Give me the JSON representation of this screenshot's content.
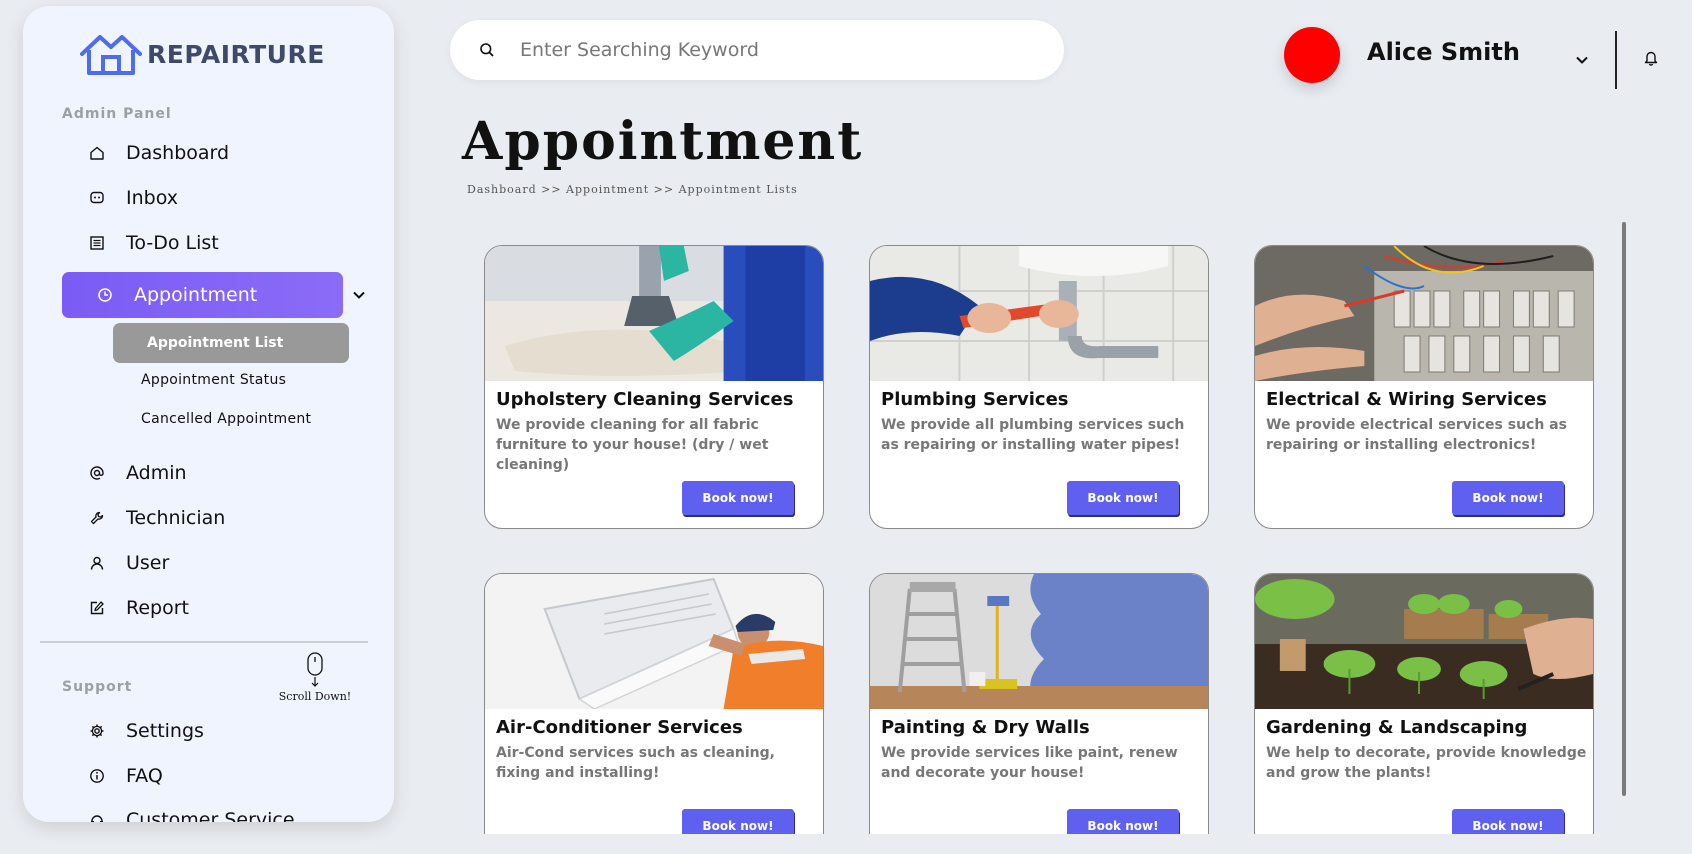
{
  "brand": {
    "name": "REPAIRTURE",
    "accent": "#4f6cf0"
  },
  "sidebar": {
    "admin_label": "Admin Panel",
    "items": [
      {
        "label": "Dashboard",
        "icon": "home-icon"
      },
      {
        "label": "Inbox",
        "icon": "chat-icon"
      },
      {
        "label": "To-Do List",
        "icon": "list-icon"
      },
      {
        "label": "Appointment",
        "icon": "clock-icon",
        "active": true
      },
      {
        "label": "Admin",
        "icon": "at-icon"
      },
      {
        "label": "Technician",
        "icon": "wrench-icon"
      },
      {
        "label": "User",
        "icon": "user-icon"
      },
      {
        "label": "Report",
        "icon": "edit-icon"
      }
    ],
    "appointment_sub": [
      {
        "label": "Appointment List",
        "active": true
      },
      {
        "label": "Appointment Status"
      },
      {
        "label": "Cancelled Appointment"
      }
    ],
    "support_label": "Support",
    "scroll_hint": "Scroll Down!",
    "support_items": [
      {
        "label": "Settings",
        "icon": "gear-icon"
      },
      {
        "label": "FAQ",
        "icon": "info-icon"
      },
      {
        "label": "Customer Service",
        "icon": "headset-icon"
      }
    ],
    "active_color": "#7a5cf4"
  },
  "search": {
    "placeholder": "Enter Searching Keyword",
    "value": ""
  },
  "user": {
    "name": "Alice Smith",
    "avatar_color": "#ff0000"
  },
  "page": {
    "title": "Appointment",
    "breadcrumb": "Dashboard >> Appointment >> Appointment Lists"
  },
  "services": [
    {
      "title": "Upholstery Cleaning Services",
      "desc": "We provide cleaning for all fabric furniture to your house! (dry / wet cleaning)",
      "button": "Book now!"
    },
    {
      "title": "Plumbing Services",
      "desc": "We provide all plumbing services such as repairing or installing water pipes!",
      "button": "Book now!"
    },
    {
      "title": "Electrical & Wiring Services",
      "desc": "We provide electrical services such as repairing or installing electronics!",
      "button": "Book now!"
    },
    {
      "title": "Air-Conditioner Services",
      "desc": "Air-Cond services such as cleaning, fixing and installing!",
      "button": "Book now!"
    },
    {
      "title": "Painting & Dry Walls",
      "desc": "We provide services like paint, renew and decorate your house!",
      "button": "Book now!"
    },
    {
      "title": "Gardening & Landscaping",
      "desc": "We help to decorate, provide knowledge and grow the plants!",
      "button": "Book now!"
    }
  ],
  "button_color": "#5f5ff0"
}
